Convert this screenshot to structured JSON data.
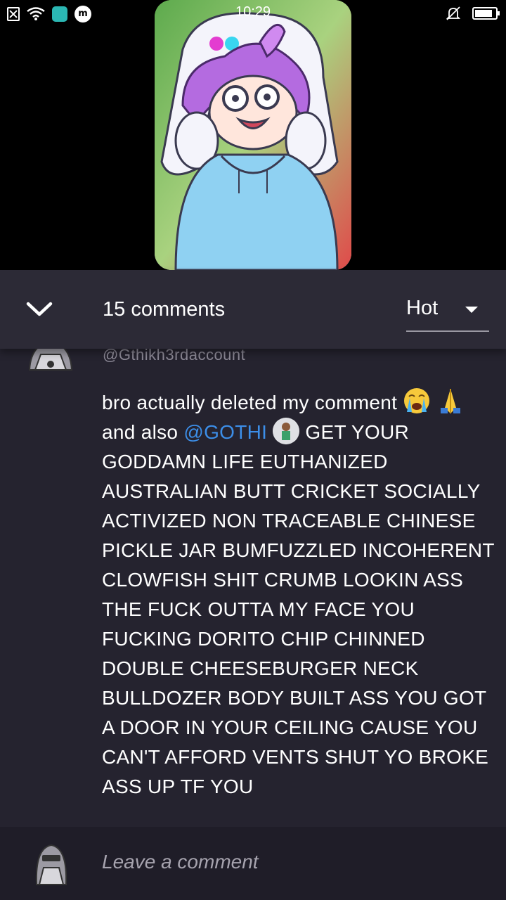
{
  "status_bar": {
    "time": "10:29",
    "app_badge_letter": "m",
    "icons": [
      "close-box-icon",
      "wifi-icon",
      "app-notification-icon",
      "m-app-icon",
      "bell-muted-icon",
      "battery-icon"
    ]
  },
  "video": {
    "thumbnail_icon": "cartoon-character-thumbnail"
  },
  "comments_panel": {
    "count_label": "15 comments",
    "sort_value": "Hot",
    "collapse_icon": "chevron-down-icon"
  },
  "comment": {
    "author": "@Gthikh3rdaccount",
    "text_part_1": "bro actually deleted my comment ",
    "emoji_1": "crying-face-emoji",
    "emoji_2": "folded-hands-emoji",
    "text_part_2": " and also ",
    "mention": "@GOTHI",
    "text_part_3": " GET YOUR GODDAMN LIFE EUTHANIZED AUSTRALIAN BUTT CRICKET SOCIALLY ACTIVIZED NON TRACEABLE CHINESE PICKLE JAR BUMFUZZLED INCOHERENT CLOWFISH SHIT CRUMB LOOKIN ASS THE FUCK OUTTA MY FACE YOU FUCKING DORITO CHIP CHINNED DOUBLE CHEESEBURGER NECK BULLDOZER BODY BUILT ASS YOU GOT A DOOR IN YOUR CEILING CAUSE YOU CAN'T AFFORD VENTS SHUT YO BROKE ASS UP TF YOU"
  },
  "composer": {
    "placeholder": "Leave a comment"
  },
  "colors": {
    "sheet_bg": "#25232f",
    "header_bg": "#2c2a36",
    "composer_bg": "#1f1d28",
    "mention": "#3c8ee8",
    "author": "#8d8a97"
  }
}
